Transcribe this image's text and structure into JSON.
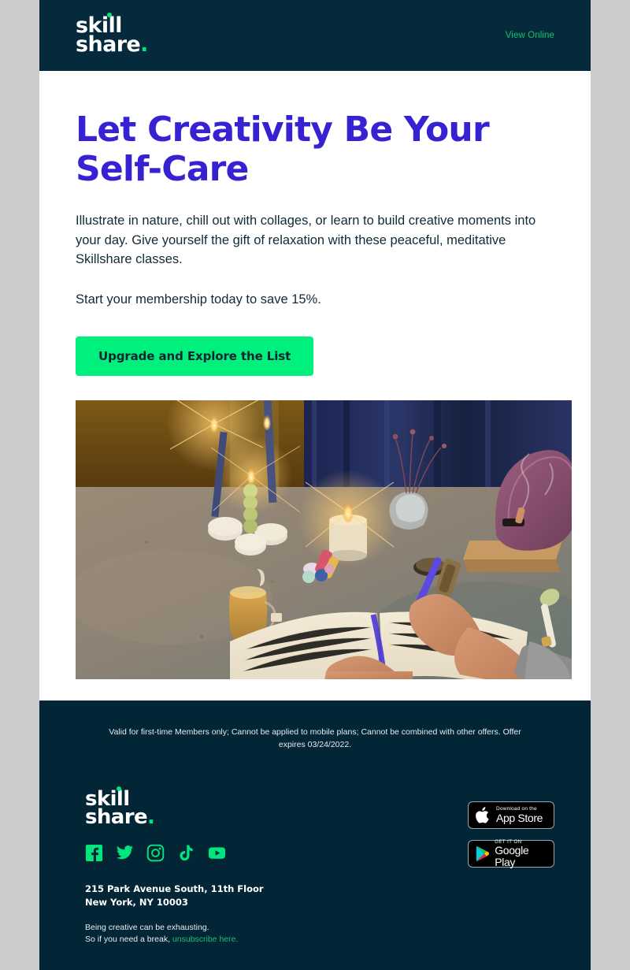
{
  "header": {
    "logo": {
      "line1": "skill",
      "line2": "share",
      "period": ".",
      "dot_color": "#00e57e"
    },
    "view_online_label": "View Online",
    "background_color": "#042a3b",
    "link_color": "#10c472"
  },
  "main": {
    "headline": "Let Creativity Be Your Self-Care",
    "paragraph_1": "Illustrate in nature, chill out with collages, or learn to build creative moments into your day. Give yourself the gift of relaxation with these peaceful, meditative Skillshare classes.",
    "paragraph_2": "Start your membership today to save 15%.",
    "cta_label": "Upgrade and Explore the List",
    "headline_color": "#3722d3",
    "cta_background": "#00f07d",
    "cta_text_color": "#0d2430",
    "hero_alt": "Candlelit desk with journal, tea, candles, crystals and incense"
  },
  "footer": {
    "disclaimer": "Valid for first-time Members only; Cannot be applied to mobile plans; Cannot be combined with other offers. Offer expires 03/24/2022.",
    "logo": {
      "line1": "skill",
      "line2": "share",
      "period": "."
    },
    "socials": [
      {
        "name": "facebook",
        "label": "Facebook"
      },
      {
        "name": "twitter",
        "label": "Twitter"
      },
      {
        "name": "instagram",
        "label": "Instagram"
      },
      {
        "name": "tiktok",
        "label": "TikTok"
      },
      {
        "name": "youtube",
        "label": "YouTube"
      }
    ],
    "address_line_1": "215 Park Avenue South, 11th Floor",
    "address_line_2": "New York, NY 10003",
    "signoff_line_1": "Being creative can be exhausting.",
    "signoff_line_2_prefix": "So if you need a break, ",
    "unsubscribe_label": "unsubscribe here.",
    "background_color": "#022636",
    "social_color": "#00e57e",
    "unsubscribe_color": "#1fbd73",
    "app_store": {
      "top_text": "Download on the",
      "bottom_text": "App Store"
    },
    "google_play": {
      "top_text": "GET IT ON",
      "bottom_text": "Google Play"
    }
  }
}
